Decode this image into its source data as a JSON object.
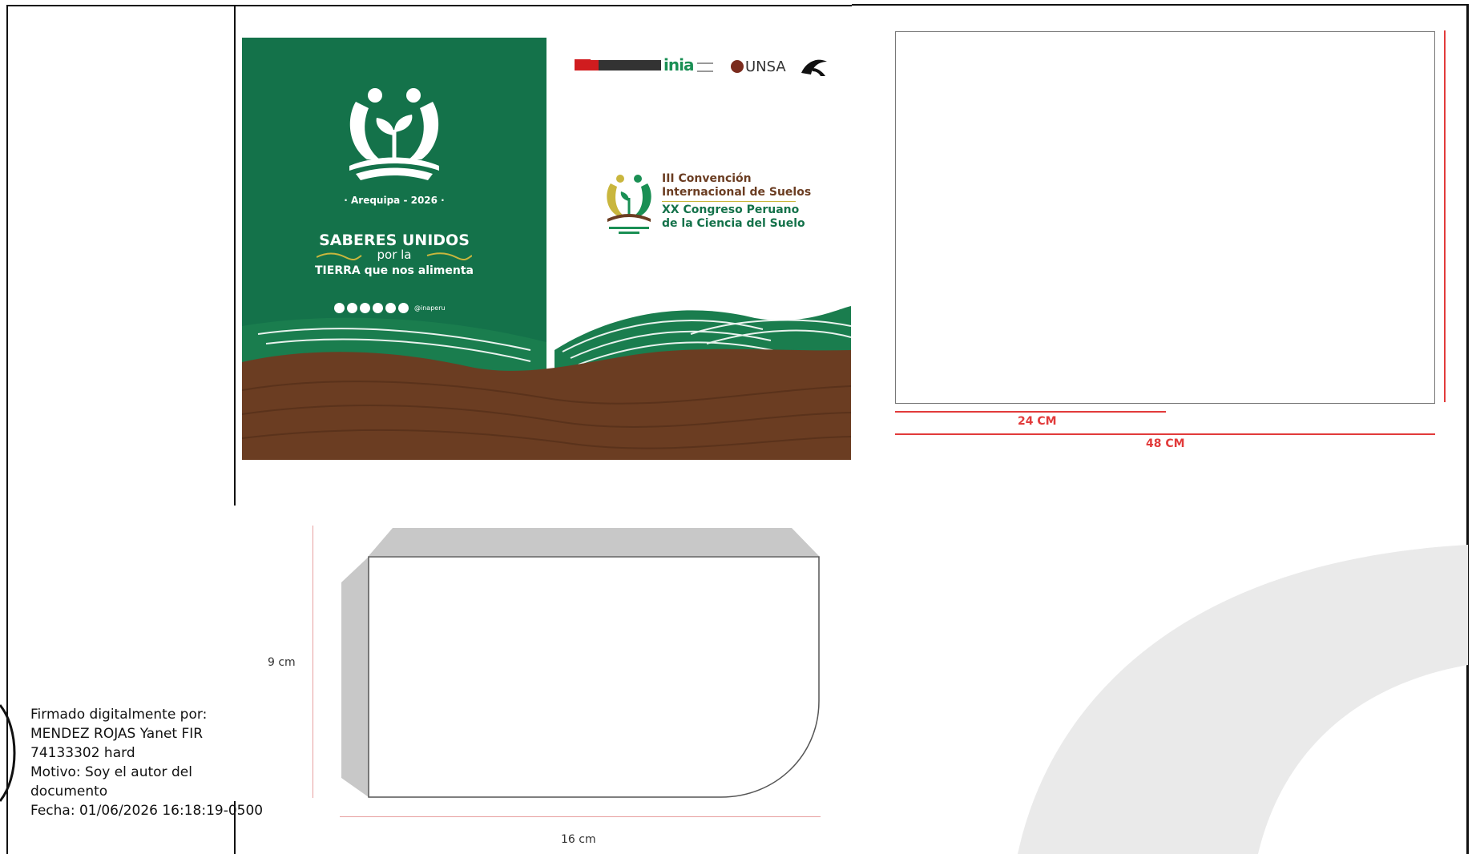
{
  "brochure": {
    "city_year": "· Arequipa - 2026 ·",
    "slogan_line1": "SABERES UNIDOS",
    "slogan_line2": "por la",
    "slogan_line3": "TIERRA que nos alimenta",
    "social_handle": "@inaperu",
    "logos": [
      "peru-government-logo",
      "inia",
      "UNSA",
      "condor-logo"
    ],
    "inia_label": "inia",
    "unsa_label": "UNSA",
    "event_line1": "III Convención",
    "event_line2": "Internacional de Suelos",
    "event_line3": "XX Congreso Peruano",
    "event_line4": "de la Ciencia del Suelo",
    "colors": {
      "green": "#14724a",
      "brown": "#6b3d22",
      "gold": "#c9b63d"
    }
  },
  "flat_template": {
    "half_width_label": "24 CM",
    "full_width_label": "48 CM",
    "dimension_color": "#e23b3b"
  },
  "envelope": {
    "height_label": "9 cm",
    "width_label": "16 cm"
  },
  "signature": {
    "line1": "Firmado digitalmente por:",
    "line2": "MENDEZ ROJAS Yanet FIR",
    "line3": "74133302 hard",
    "line4": "Motivo: Soy el autor del",
    "line5": "documento",
    "line6": "Fecha: 01/06/2026 16:18:19-0500"
  }
}
